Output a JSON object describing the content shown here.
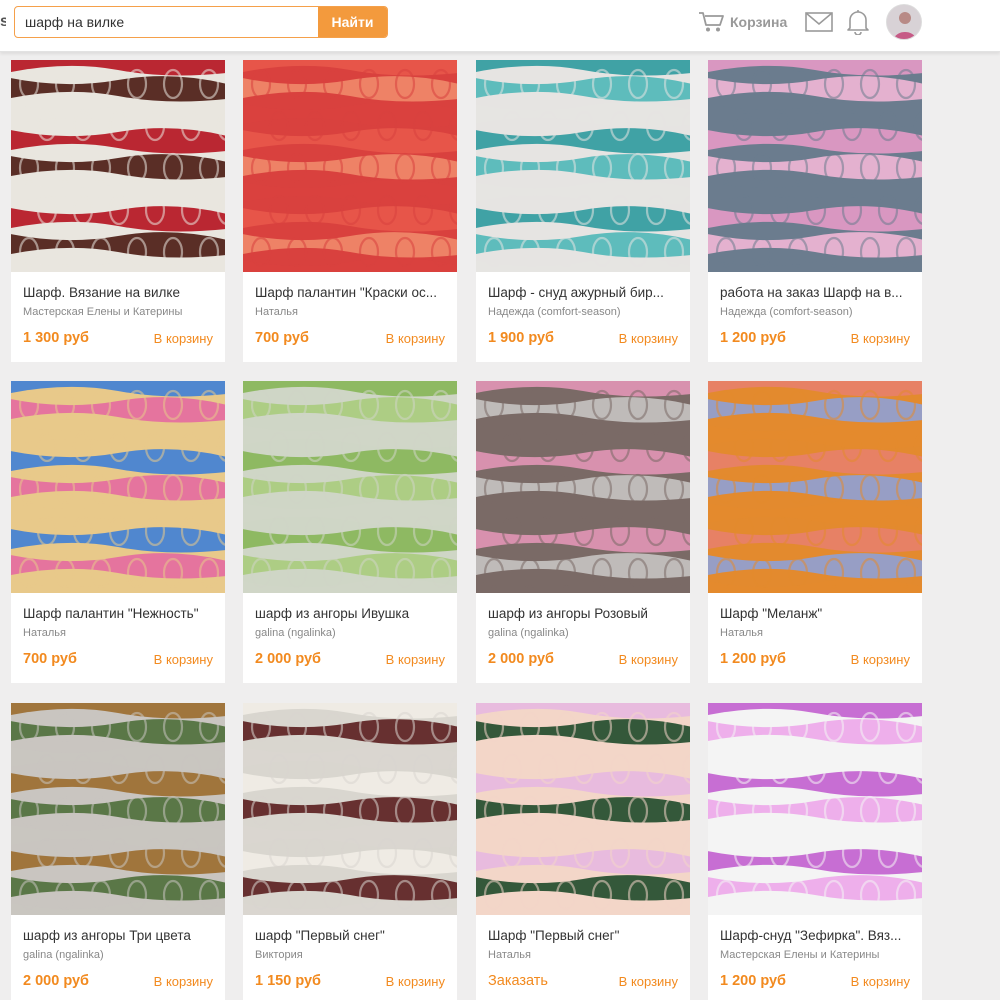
{
  "header": {
    "logo_fragment": "s",
    "search": {
      "value": "шарф на вилке",
      "button_label": "Найти"
    },
    "cart_label": "Корзина"
  },
  "products": [
    {
      "title": "Шарф. Вязание на вилке",
      "seller": "Мастерская Елены и Катерины",
      "price": "1 300 руб",
      "cart": "В корзину",
      "colors": [
        "#b5121f",
        "#4a1a12",
        "#e9e6df"
      ]
    },
    {
      "title": "Шарф палантин \"Краски ос...",
      "seller": "Наталья",
      "price": "700 руб",
      "cart": "В корзину",
      "colors": [
        "#e8584a",
        "#f08a6a",
        "#d9413e"
      ]
    },
    {
      "title": "Шарф - снуд ажурный бир...",
      "seller": "Надежда (comfort-season)",
      "price": "1 900 руб",
      "cart": "В корзину",
      "colors": [
        "#2e9a9e",
        "#4fb7b8",
        "#e6e4e2"
      ]
    },
    {
      "title": "работа на заказ Шарф на в...",
      "seller": "Надежда (comfort-season)",
      "price": "1 200 руб",
      "cart": "В корзину",
      "colors": [
        "#e69ac6",
        "#f2b7d6",
        "#6b7c8e"
      ]
    },
    {
      "title": "Шарф палантин \"Нежность\"",
      "seller": "Наталья",
      "price": "700 руб",
      "cart": "В корзину",
      "colors": [
        "#3f7fd6",
        "#e46aa0",
        "#e8c98a"
      ]
    },
    {
      "title": "шарф из ангоры Ивушка",
      "seller": "galina (ngalinka)",
      "price": "2 000 руб",
      "cart": "В корзину",
      "colors": [
        "#86b656",
        "#a9cc7c",
        "#cfd6c6"
      ]
    },
    {
      "title": "шарф из ангоры Розовый",
      "seller": "galina (ngalinka)",
      "price": "2 000 руб",
      "cart": "В корзину",
      "colors": [
        "#e296b6",
        "#c7c4c2",
        "#7a6a66"
      ]
    },
    {
      "title": "Шарф \"Меланж\"",
      "seller": "Наталья",
      "price": "1 200 руб",
      "cart": "В корзину",
      "colors": [
        "#e77f6c",
        "#8ea0d6",
        "#e38a2e"
      ]
    },
    {
      "title": "шарф из ангоры Три цвета",
      "seller": "galina (ngalinka)",
      "price": "2 000 руб",
      "cart": "В корзину",
      "colors": [
        "#9b6b2e",
        "#4e6e3a",
        "#c9c5c0"
      ]
    },
    {
      "title": "шарф \"Первый снег\"",
      "seller": "Виктория",
      "price": "1 150 руб",
      "cart": "В корзину",
      "colors": [
        "#f1ede6",
        "#5a1e1e",
        "#d9d6cf"
      ]
    },
    {
      "title": "Шарф \"Первый снег\"",
      "seller": "Наталья",
      "price": "Заказать",
      "cart": "В корзину",
      "colors": [
        "#e7b8e0",
        "#1f4a2a",
        "#f3d6c8"
      ]
    },
    {
      "title": "Шарф-снуд \"Зефирка\". Вяз...",
      "seller": "Мастерская Елены и Катерины",
      "price": "1 200 руб",
      "cart": "В корзину",
      "colors": [
        "#c25fcf",
        "#eda7ea",
        "#f4f4f4"
      ]
    }
  ]
}
